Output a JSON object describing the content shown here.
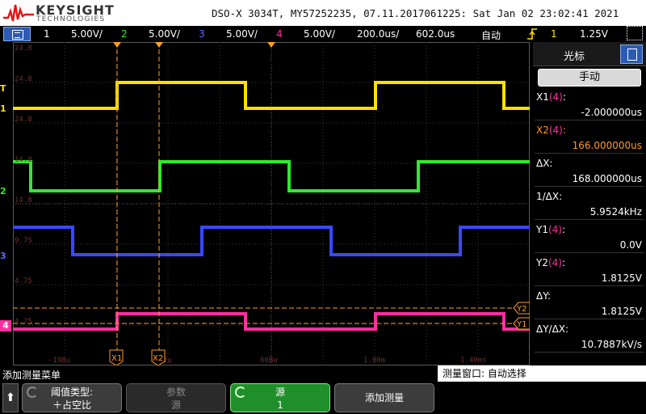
{
  "header": {
    "brand": "KEYSIGHT",
    "brand_sub": "TECHNOLOGIES",
    "device_info": "DSO-X 3034T, MY57252235, 07.11.2017061225: Sat Jan 02 23:02:41 2021"
  },
  "statusbar": {
    "channels": [
      {
        "num": "1",
        "scale": "5.00V/",
        "color": "#ffe000"
      },
      {
        "num": "2",
        "scale": "5.00V/",
        "color": "#2eea2e"
      },
      {
        "num": "3",
        "scale": "5.00V/",
        "color": "#3a48ff"
      },
      {
        "num": "4",
        "scale": "5.00V/",
        "color": "#ff2ea0"
      }
    ],
    "timebase": "200.0us/",
    "delay": "602.0us",
    "trigger_mode": "自动",
    "trigger_channel": "1",
    "trigger_level": "1.25V"
  },
  "grid": {
    "level_labels": [
      "24.8",
      "24.8",
      "24.8",
      "14.8",
      "14.8",
      "9.75",
      "4.75",
      "4.75"
    ],
    "time_labels": [
      "-198u",
      "2u",
      "60Bu",
      "1.00m",
      "1.40ms"
    ],
    "cursor_labels": [
      "X1",
      "X2",
      "Y2",
      "Y1"
    ],
    "trigger_marker": "T",
    "channel_markers": [
      "1",
      "2",
      "3",
      "4"
    ]
  },
  "side": {
    "title": "光标",
    "mode": "手动",
    "readouts": [
      {
        "label": "X1",
        "src": "(4)",
        "label_after": ":",
        "value": "-2.000000us",
        "color": "#fff"
      },
      {
        "label": "X2",
        "src": "(4)",
        "label_after": ":",
        "value": "166.000000us",
        "color": "#ff9a1a"
      },
      {
        "label": "ΔX:",
        "src": "",
        "label_after": "",
        "value": "168.000000us",
        "color": "#fff"
      },
      {
        "label": "1/ΔX:",
        "src": "",
        "label_after": "",
        "value": "5.9524kHz",
        "color": "#fff"
      },
      {
        "label": "Y1",
        "src": "(4)",
        "label_after": ":",
        "value": "0.0V",
        "color": "#fff"
      },
      {
        "label": "Y2",
        "src": "(4)",
        "label_after": ":",
        "value": "1.8125V",
        "color": "#fff"
      },
      {
        "label": "ΔY:",
        "src": "",
        "label_after": "",
        "value": "1.8125V",
        "color": "#fff"
      },
      {
        "label": "ΔY/ΔX:",
        "src": "",
        "label_after": "",
        "value": "10.7887kV/s",
        "color": "#fff"
      }
    ]
  },
  "bottom": {
    "submenu_title": "添加测量菜单",
    "meas_window": "测量窗口: 自动选择",
    "softkeys": [
      {
        "l1": "阈值类型:",
        "l2": "＋占空比"
      },
      {
        "l1": "参数",
        "l2": "源"
      },
      {
        "l1": "源",
        "l2": "1"
      },
      {
        "l1": "添加测量",
        "l2": ""
      }
    ]
  },
  "colors": {
    "ch1": "#ffe000",
    "ch2": "#2eea2e",
    "ch3": "#3a48ff",
    "ch4": "#ff2ea0",
    "cursor": "#ffa020",
    "accent_blue": "#2c5bb3",
    "active_green": "#1f8f2a"
  },
  "icons": [
    "menu-icon",
    "trigger-edge-icon",
    "zoom-icon",
    "doc-icon",
    "up-arrow-icon",
    "refresh-icon"
  ]
}
